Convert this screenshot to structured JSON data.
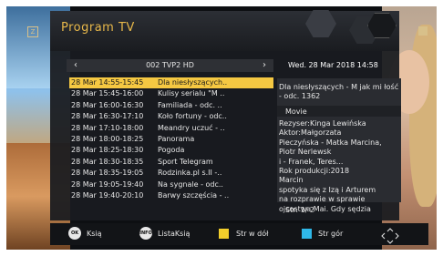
{
  "header": {
    "title": "Program TV"
  },
  "channel": {
    "name": "002 TVP2 HD"
  },
  "datetime": "Wed.  28 Mar 2018 14:58",
  "programs": [
    {
      "time": "28 Mar 14:55-15:45",
      "title": "Dla niesłyszących.."
    },
    {
      "time": "28 Mar 15:45-16:00",
      "title": "Kulisy serialu \"M .."
    },
    {
      "time": "28 Mar 16:00-16:30",
      "title": "Familiada - odc. .."
    },
    {
      "time": "28 Mar 16:30-17:10",
      "title": "Koło fortuny - odc.."
    },
    {
      "time": "28 Mar 17:10-18:00",
      "title": "Meandry uczuć - .."
    },
    {
      "time": "28 Mar 18:00-18:25",
      "title": "Panorama"
    },
    {
      "time": "28 Mar 18:25-18:30",
      "title": "Pogoda"
    },
    {
      "time": "28 Mar 18:30-18:35",
      "title": "Sport Telegram"
    },
    {
      "time": "28 Mar 18:35-19:05",
      "title": "Rodzinka.pl s.II -.."
    },
    {
      "time": "28 Mar 19:05-19:40",
      "title": "Na sygnale - odc.."
    },
    {
      "time": "28 Mar 19:40-20:10",
      "title": "Barwy szczęścia - .."
    }
  ],
  "detail": {
    "description": "Dla niesłyszących - M jak mi łość - odc. 1362",
    "genre": "Movie",
    "lines": [
      "Rezyser:Kinga Lewińska",
      "Aktor:Małgorzata",
      "Pieczyńska - Matka Marcina,",
      "Piotr Nerlewsk",
      "i - Franek, Teres...",
      "Rok produkcji:2018",
      "Marcin",
      "spotyka się z Izą i Arturem",
      "na rozprawie w sprawie",
      "ojcostwa Mai. Gdy sędzia"
    ],
    "pages": "Str:  1/ 2"
  },
  "help": {
    "ok_badge": "OK",
    "ok_label": "Ksią",
    "info_badge": "INFO",
    "info_label": "ListaKsią",
    "yellow_label": "Str w dół",
    "blue_label": "Str gór"
  },
  "colors": {
    "accent": "#e8b84a",
    "selected_row": "#f5c842",
    "yellow_key": "#f3cf2b",
    "blue_key": "#2fb8e8"
  }
}
